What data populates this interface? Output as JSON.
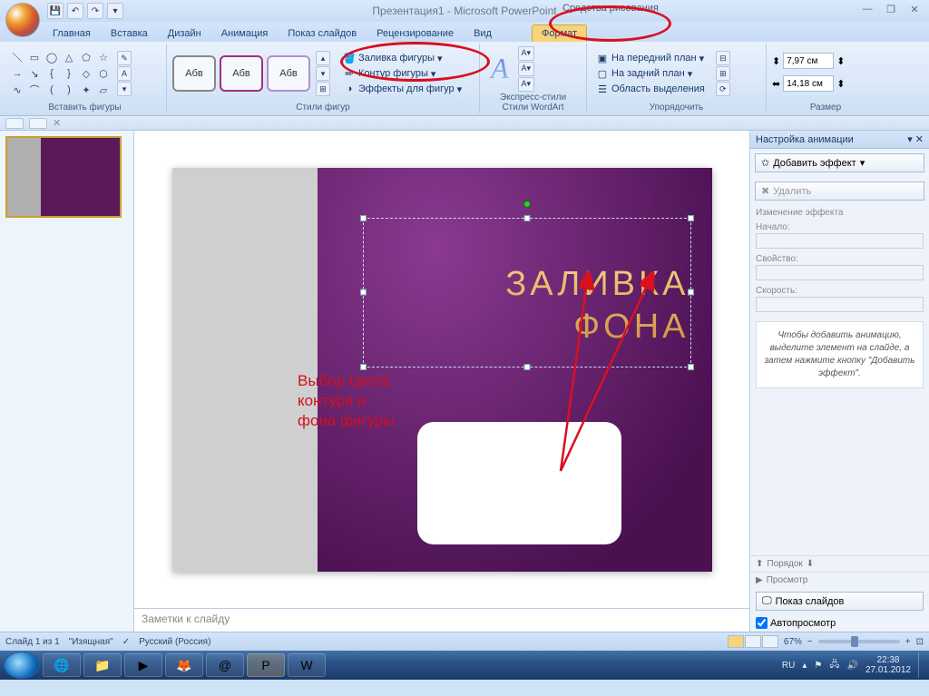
{
  "title": "Презентация1 - Microsoft PowerPoint",
  "tool_context": "Средства рисования",
  "tabs": {
    "home": "Главная",
    "insert": "Вставка",
    "design": "Дизайн",
    "animation": "Анимация",
    "slideshow": "Показ слайдов",
    "review": "Рецензирование",
    "view": "Вид",
    "format": "Формат"
  },
  "ribbon": {
    "insert_shapes": "Вставить фигуры",
    "shape_styles": "Стили фигур",
    "wordart_styles": "Стили WordArt",
    "arrange": "Упорядочить",
    "size": "Размер",
    "abv": "Абв",
    "shape_fill": "Заливка фигуры",
    "shape_outline": "Контур фигуры",
    "shape_effects": "Эффекты для фигур",
    "express_styles": "Экспресс-стили",
    "bring_front": "На передний план",
    "send_back": "На задний план",
    "selection_pane": "Область выделения",
    "height": "7,97 см",
    "width": "14,18 см"
  },
  "slide": {
    "title_line1": "ЗАЛИВКА",
    "title_line2": "ФОНА"
  },
  "annotation": "Выбор цвета контура и фона фигуры",
  "notes_placeholder": "Заметки к слайду",
  "taskpane": {
    "title": "Настройка анимации",
    "add_effect": "Добавить эффект",
    "remove": "Удалить",
    "change_effect": "Изменение эффекта",
    "start": "Начало:",
    "property": "Свойство:",
    "speed": "Скорость:",
    "hint": "Чтобы добавить анимацию, выделите элемент на слайде, а затем нажмите кнопку \"Добавить эффект\".",
    "order": "Порядок",
    "preview": "Просмотр",
    "slideshow": "Показ слайдов",
    "autopreview": "Автопросмотр"
  },
  "status": {
    "slide_of": "Слайд 1 из 1",
    "theme": "\"Изящная\"",
    "language": "Русский (Россия)",
    "zoom": "67%"
  },
  "taskbar": {
    "lang": "RU",
    "time": "22:38",
    "date": "27.01.2012"
  }
}
